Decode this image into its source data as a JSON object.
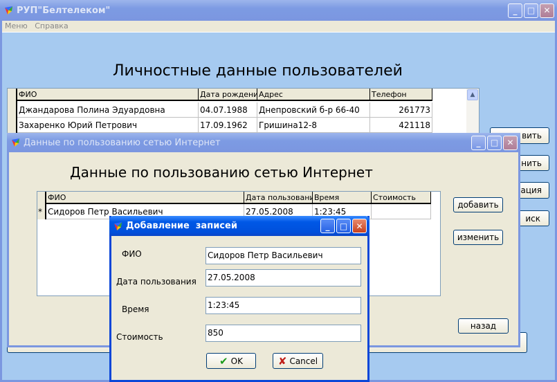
{
  "main": {
    "title": "РУП\"Белтелеком\"",
    "menu": [
      "Меню",
      "Справка"
    ],
    "heading": "Личностные данные пользователей",
    "columns": [
      "ФИО",
      "Дата рождения",
      "Адрес",
      "Телефон"
    ],
    "rows": [
      [
        "Джандарова Полина Эдуардовна",
        "04.07.1988",
        "Днепровский б-р 66-40",
        "261773"
      ],
      [
        "Захаренко Юрий Петрович",
        "17.09.1962",
        "Гришина12-8",
        "421118"
      ]
    ],
    "side_buttons": [
      "вить",
      "нить",
      "рация",
      "иск"
    ]
  },
  "internet": {
    "title": "Данные по пользованию сетью Интернет",
    "heading": "Данные по пользованию сетью Интернет",
    "columns": [
      "ФИО",
      "Дата пользования",
      "Время",
      "Стоимость"
    ],
    "rows": [
      {
        "marker": "*",
        "cells": [
          "Сидоров Петр Васильевич",
          "27.05.2008",
          "1:23:45",
          ""
        ]
      }
    ],
    "add": "добавить",
    "edit": "изменить",
    "back": "назад"
  },
  "dialog": {
    "title": "Добавление  записей",
    "fields": [
      {
        "label": "ФИО",
        "value": "Сидоров Петр Васильевич"
      },
      {
        "label": "Дата пользования",
        "value": "27.05.2008"
      },
      {
        "label": "Время",
        "value": "1:23:45"
      },
      {
        "label": "Стоимость",
        "value": "850"
      }
    ],
    "ok": "OK",
    "cancel": "Cancel"
  }
}
